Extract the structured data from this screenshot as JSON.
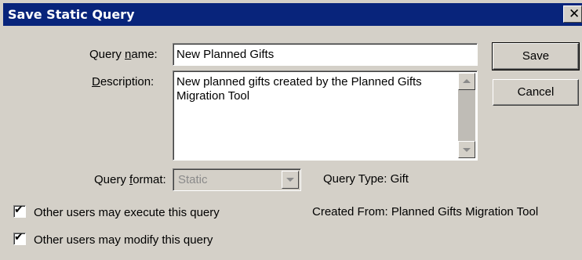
{
  "window": {
    "title": "Save Static Query",
    "close_glyph": "✕"
  },
  "form": {
    "query_name": {
      "label_pre": "Query ",
      "label_accel": "n",
      "label_post": "ame:",
      "value": "New Planned Gifts"
    },
    "description": {
      "label_pre": "",
      "label_accel": "D",
      "label_post": "escription:",
      "value": "New planned gifts created by the Planned Gifts Migration Tool"
    },
    "query_format": {
      "label_pre": "Query ",
      "label_accel": "f",
      "label_post": "ormat:",
      "value": "Static"
    },
    "query_type": "Query Type: Gift",
    "created_from": "Created From: Planned Gifts Migration Tool"
  },
  "checkboxes": [
    {
      "label": "Other users may execute this query",
      "checked": true
    },
    {
      "label": "Other users may modify this query",
      "checked": true
    }
  ],
  "buttons": {
    "save": "Save",
    "cancel": "Cancel"
  },
  "colors": {
    "titlebar": "#08247b",
    "face": "#d4d0c8"
  }
}
